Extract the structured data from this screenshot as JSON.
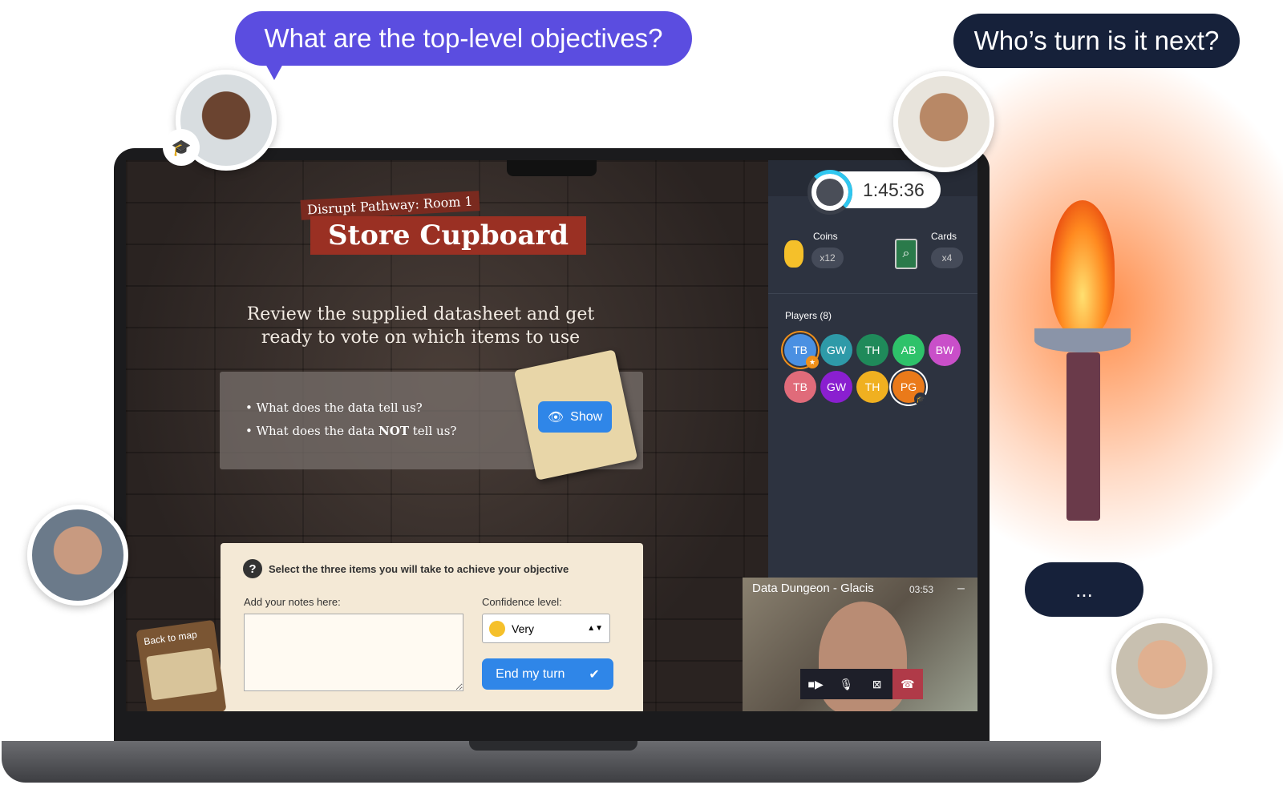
{
  "bubbles": {
    "left": "What are the top-level objectives?",
    "right": "Who’s turn is it next?",
    "typing": "..."
  },
  "game": {
    "room_label": "Disrupt Pathway: Room 1",
    "room_title": "Store Cupboard",
    "intro": "Review the supplied datasheet and get ready to vote on which items to use",
    "questions": [
      "What does the data tell us?",
      "What does the data NOT tell us?"
    ],
    "show_label": "Show",
    "task": {
      "instruction": "Select the three items you will take to achieve your objective",
      "notes_label": "Add your notes here:",
      "notes_value": "",
      "confidence_label": "Confidence level:",
      "confidence_value": "Very",
      "end_turn_label": "End my turn"
    },
    "back_to_map": "Back to map"
  },
  "sidebar": {
    "timer": "1:45:36",
    "timer_progress": 0.25,
    "coins_label": "Coins",
    "coins_value": "x12",
    "cards_label": "Cards",
    "cards_value": "x4",
    "players_label": "Players (8)",
    "players": [
      {
        "initials": "TB",
        "color": "#4a90e2",
        "badge": "star"
      },
      {
        "initials": "GW",
        "color": "#2e9aa8"
      },
      {
        "initials": "TH",
        "color": "#1f8a5a"
      },
      {
        "initials": "AB",
        "color": "#2ec26a"
      },
      {
        "initials": "BW",
        "color": "#c94fc9"
      },
      {
        "initials": "TB",
        "color": "#e06b7a"
      },
      {
        "initials": "GW",
        "color": "#8a1fd0"
      },
      {
        "initials": "TH",
        "color": "#f0b020"
      },
      {
        "initials": "PG",
        "color": "#ea7a1a",
        "badge": "graduation-cap"
      }
    ]
  },
  "video": {
    "title": "Data Dungeon - Glacis",
    "time": "03:53",
    "minimize": "–"
  },
  "colors": {
    "accent": "#2f86e8",
    "bubble_purple": "#5b4de0",
    "bubble_dark": "#16213a",
    "sidebar": "#2d3340",
    "title_red": "#9a3023"
  }
}
